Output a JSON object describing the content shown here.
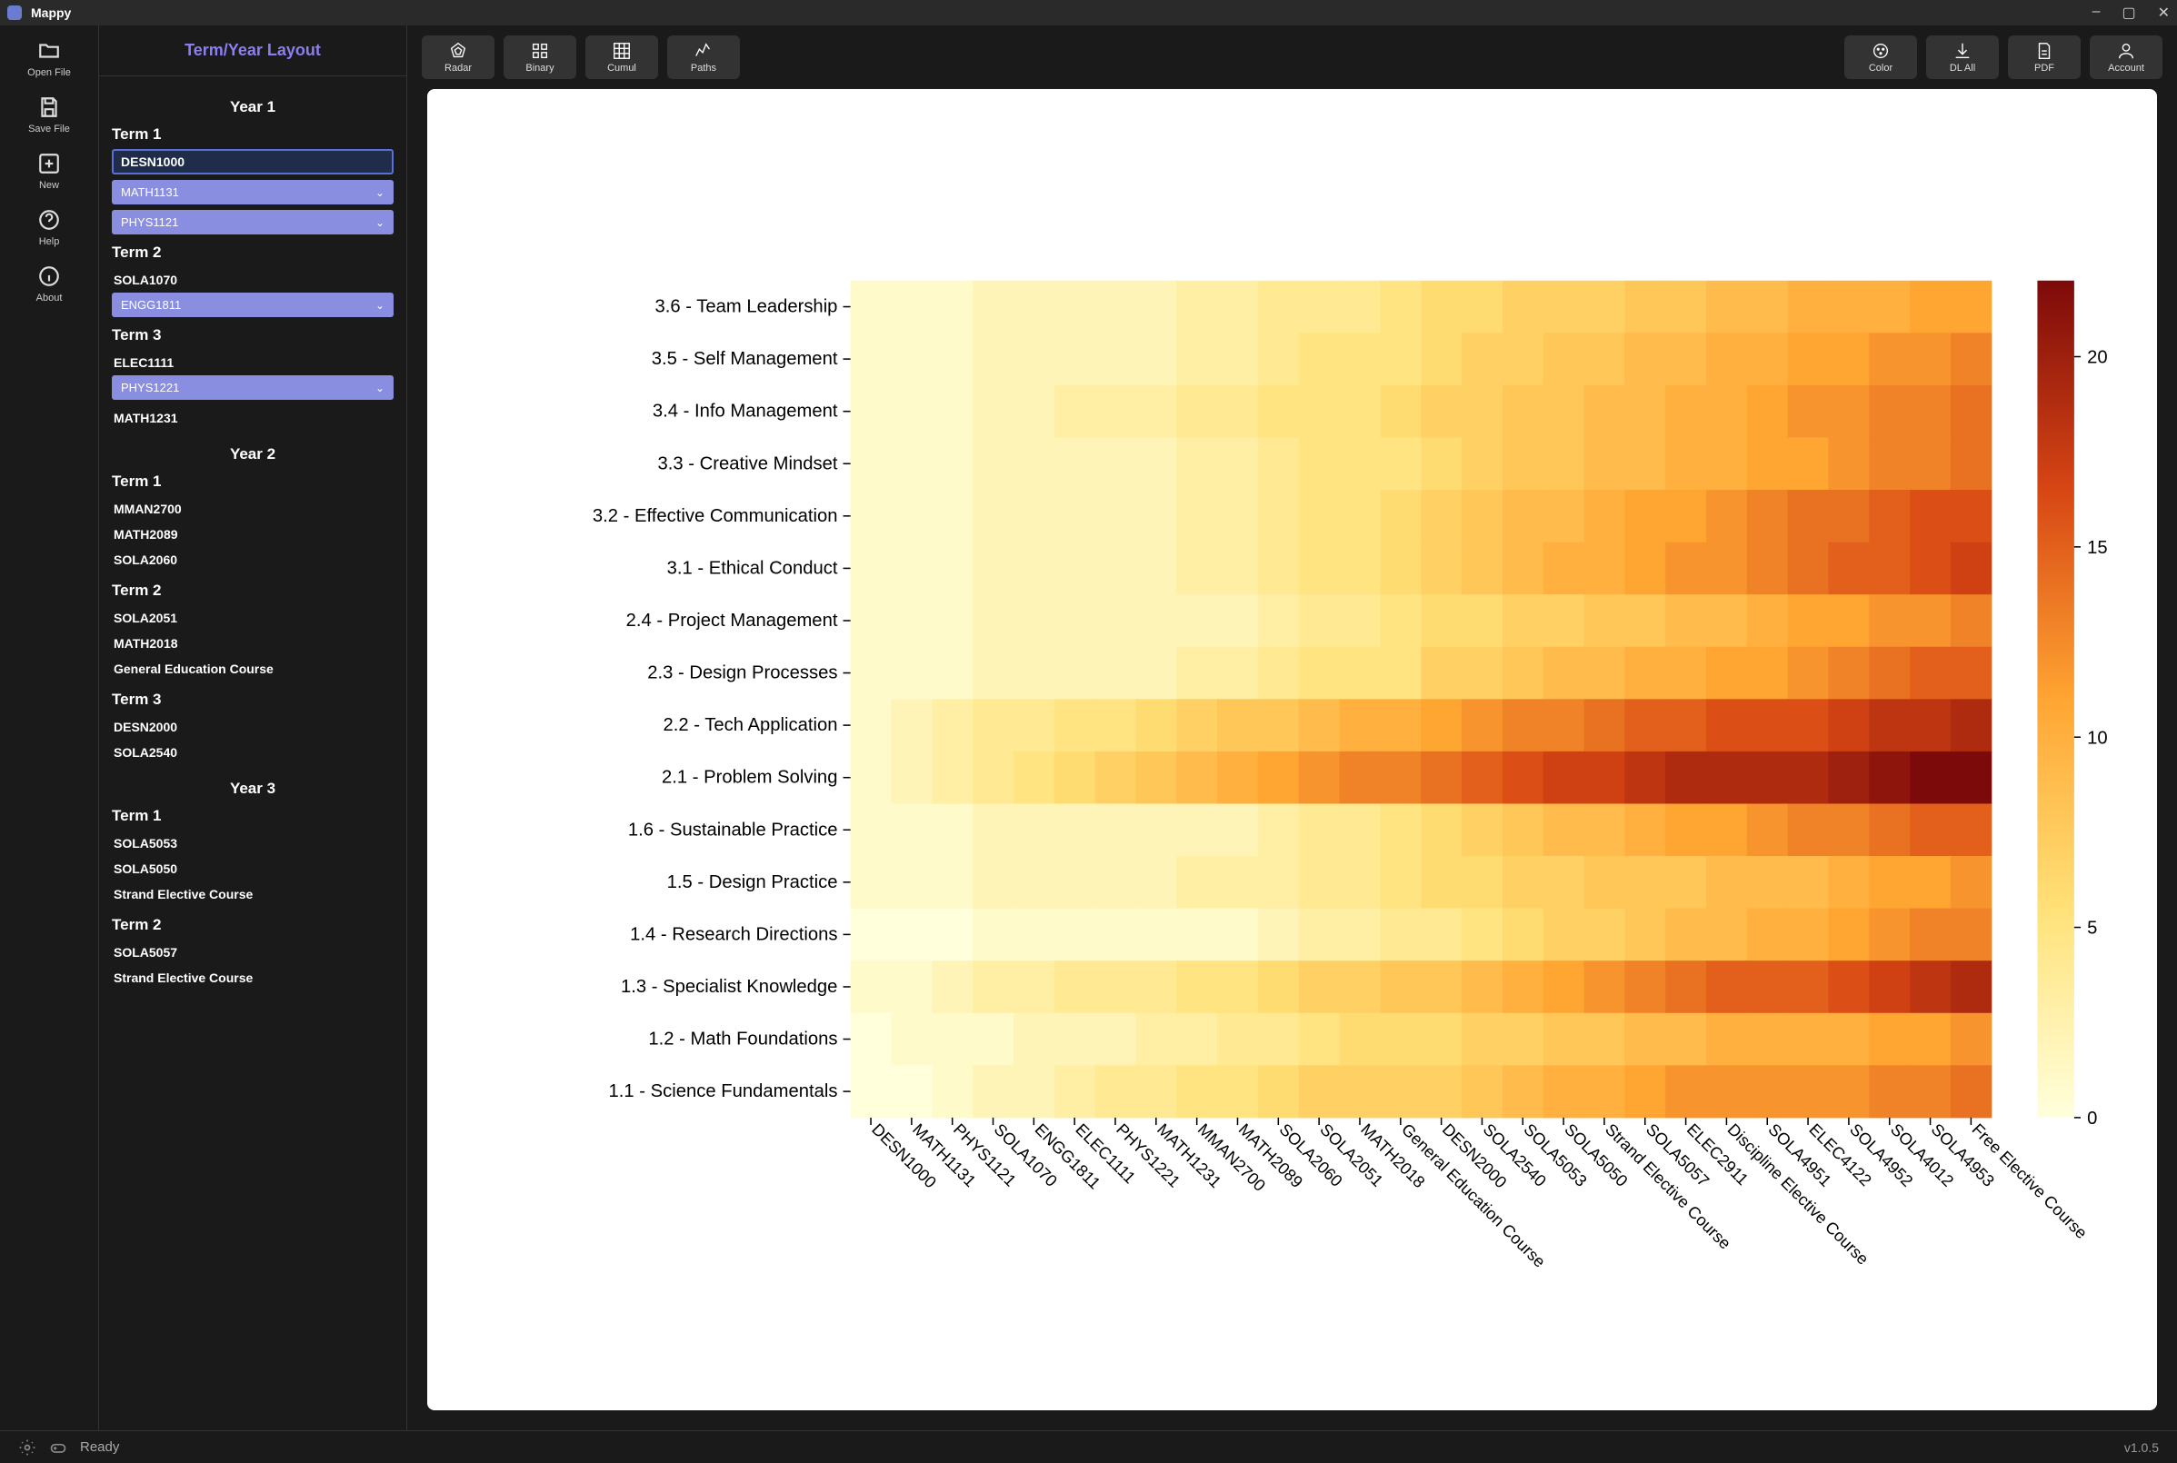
{
  "app": {
    "title": "Mappy"
  },
  "window": {
    "minimize": "–",
    "maximize": "▢",
    "close": "✕"
  },
  "rail": {
    "open": "Open File",
    "save": "Save File",
    "new": "New",
    "help": "Help",
    "about": "About"
  },
  "sidebar": {
    "title": "Term/Year Layout",
    "years": [
      {
        "name": "Year 1",
        "terms": [
          {
            "name": "Term 1",
            "courses": [
              {
                "code": "DESN1000",
                "style": "selected"
              },
              {
                "code": "MATH1131",
                "style": "pill"
              },
              {
                "code": "PHYS1121",
                "style": "pill"
              }
            ]
          },
          {
            "name": "Term 2",
            "courses": [
              {
                "code": "SOLA1070",
                "style": "plain"
              },
              {
                "code": "ENGG1811",
                "style": "pill"
              }
            ]
          },
          {
            "name": "Term 3",
            "courses": [
              {
                "code": "ELEC1111",
                "style": "plain"
              },
              {
                "code": "PHYS1221",
                "style": "pill"
              },
              {
                "code": "MATH1231",
                "style": "plain"
              }
            ]
          }
        ]
      },
      {
        "name": "Year 2",
        "terms": [
          {
            "name": "Term 1",
            "courses": [
              {
                "code": "MMAN2700",
                "style": "plain"
              },
              {
                "code": "MATH2089",
                "style": "plain"
              },
              {
                "code": "SOLA2060",
                "style": "plain"
              }
            ]
          },
          {
            "name": "Term 2",
            "courses": [
              {
                "code": "SOLA2051",
                "style": "plain"
              },
              {
                "code": "MATH2018",
                "style": "plain"
              },
              {
                "code": "General Education Course",
                "style": "plain"
              }
            ]
          },
          {
            "name": "Term 3",
            "courses": [
              {
                "code": "DESN2000",
                "style": "plain"
              },
              {
                "code": "SOLA2540",
                "style": "plain"
              }
            ]
          }
        ]
      },
      {
        "name": "Year 3",
        "terms": [
          {
            "name": "Term 1",
            "courses": [
              {
                "code": "SOLA5053",
                "style": "plain"
              },
              {
                "code": "SOLA5050",
                "style": "plain"
              },
              {
                "code": "Strand Elective Course",
                "style": "plain"
              }
            ]
          },
          {
            "name": "Term 2",
            "courses": [
              {
                "code": "SOLA5057",
                "style": "plain"
              },
              {
                "code": "Strand Elective Course",
                "style": "plain"
              }
            ]
          }
        ]
      }
    ]
  },
  "toolbar": {
    "left": [
      {
        "key": "radar",
        "label": "Radar"
      },
      {
        "key": "binary",
        "label": "Binary"
      },
      {
        "key": "cumul",
        "label": "Cumul"
      },
      {
        "key": "paths",
        "label": "Paths"
      }
    ],
    "right": [
      {
        "key": "color",
        "label": "Color"
      },
      {
        "key": "dlall",
        "label": "DL All"
      },
      {
        "key": "pdf",
        "label": "PDF"
      },
      {
        "key": "account",
        "label": "Account"
      }
    ]
  },
  "status": {
    "text": "Ready",
    "version": "v1.0.5"
  },
  "chart_data": {
    "type": "heatmap",
    "title": "",
    "ylabels": [
      "3.6 - Team Leadership",
      "3.5 - Self Management",
      "3.4 - Info Management",
      "3.3 - Creative Mindset",
      "3.2 - Effective Communication",
      "3.1 - Ethical Conduct",
      "2.4 - Project Management",
      "2.3 - Design Processes",
      "2.2 - Tech Application",
      "2.1 - Problem Solving",
      "1.6 - Sustainable Practice",
      "1.5 - Design Practice",
      "1.4 - Research Directions",
      "1.3 - Specialist Knowledge",
      "1.2 - Math Foundations",
      "1.1 - Science Fundamentals"
    ],
    "xlabels": [
      "DESN1000",
      "MATH1131",
      "PHYS1121",
      "SOLA1070",
      "ENGG1811",
      "ELEC1111",
      "PHYS1221",
      "MATH1231",
      "MMAN2700",
      "MATH2089",
      "SOLA2060",
      "SOLA2051",
      "MATH2018",
      "General Education Course",
      "DESN2000",
      "SOLA2540",
      "SOLA5053",
      "SOLA5050",
      "Strand Elective Course",
      "SOLA5057",
      "ELEC2911",
      "Discipline Elective Course",
      "SOLA4951",
      "ELEC4122",
      "SOLA4952",
      "SOLA4012",
      "SOLA4953",
      "Free Elective Course"
    ],
    "colorbar_ticks": [
      0,
      5,
      10,
      15,
      20
    ],
    "colorbar_range": [
      0,
      22
    ],
    "values": [
      [
        1,
        1,
        1,
        2,
        2,
        2,
        2,
        2,
        3,
        3,
        4,
        4,
        4,
        5,
        6,
        6,
        7,
        7,
        7,
        8,
        8,
        9,
        9,
        10,
        10,
        10,
        11,
        11
      ],
      [
        1,
        1,
        1,
        2,
        2,
        2,
        2,
        2,
        3,
        3,
        4,
        5,
        5,
        5,
        6,
        7,
        7,
        8,
        8,
        9,
        9,
        10,
        10,
        11,
        11,
        12,
        12,
        13
      ],
      [
        1,
        1,
        1,
        2,
        2,
        3,
        3,
        3,
        4,
        4,
        5,
        5,
        5,
        6,
        7,
        7,
        8,
        8,
        9,
        9,
        10,
        10,
        11,
        12,
        12,
        13,
        13,
        14
      ],
      [
        1,
        1,
        1,
        2,
        2,
        2,
        2,
        2,
        3,
        3,
        4,
        5,
        5,
        5,
        6,
        7,
        8,
        8,
        9,
        9,
        10,
        10,
        11,
        11,
        12,
        13,
        13,
        14
      ],
      [
        1,
        1,
        1,
        2,
        2,
        2,
        2,
        2,
        3,
        3,
        4,
        5,
        5,
        6,
        7,
        8,
        9,
        9,
        10,
        11,
        11,
        12,
        13,
        14,
        14,
        15,
        16,
        16
      ],
      [
        1,
        1,
        1,
        2,
        2,
        2,
        2,
        2,
        3,
        3,
        4,
        5,
        5,
        6,
        7,
        8,
        9,
        10,
        10,
        11,
        12,
        12,
        13,
        14,
        15,
        15,
        16,
        17
      ],
      [
        1,
        1,
        1,
        2,
        2,
        2,
        2,
        2,
        2,
        2,
        3,
        4,
        4,
        5,
        6,
        6,
        7,
        7,
        8,
        8,
        9,
        9,
        10,
        11,
        11,
        12,
        12,
        13
      ],
      [
        1,
        1,
        1,
        2,
        2,
        2,
        2,
        2,
        3,
        3,
        4,
        5,
        5,
        5,
        7,
        7,
        8,
        9,
        9,
        10,
        10,
        11,
        11,
        12,
        13,
        14,
        15,
        15
      ],
      [
        1,
        2,
        3,
        4,
        4,
        5,
        5,
        6,
        7,
        8,
        8,
        9,
        10,
        10,
        11,
        12,
        13,
        13,
        14,
        15,
        15,
        16,
        16,
        16,
        17,
        18,
        18,
        19
      ],
      [
        1,
        2,
        3,
        4,
        5,
        6,
        7,
        8,
        9,
        10,
        11,
        12,
        13,
        13,
        14,
        15,
        16,
        17,
        17,
        18,
        19,
        19,
        19,
        19,
        20,
        21,
        22,
        22
      ],
      [
        1,
        1,
        1,
        2,
        2,
        2,
        2,
        2,
        2,
        2,
        3,
        4,
        4,
        5,
        6,
        7,
        8,
        9,
        9,
        10,
        11,
        11,
        12,
        13,
        13,
        14,
        15,
        15
      ],
      [
        1,
        1,
        1,
        2,
        2,
        2,
        2,
        2,
        3,
        3,
        3,
        4,
        4,
        5,
        6,
        6,
        7,
        7,
        8,
        8,
        8,
        9,
        9,
        9,
        10,
        11,
        11,
        12
      ],
      [
        0,
        0,
        0,
        1,
        1,
        1,
        1,
        1,
        1,
        1,
        2,
        3,
        3,
        4,
        4,
        5,
        6,
        7,
        7,
        8,
        9,
        9,
        10,
        10,
        11,
        12,
        13,
        13
      ],
      [
        1,
        1,
        2,
        3,
        3,
        4,
        4,
        4,
        5,
        5,
        6,
        7,
        7,
        8,
        8,
        9,
        10,
        11,
        12,
        13,
        14,
        15,
        15,
        15,
        16,
        17,
        18,
        19
      ],
      [
        0,
        1,
        1,
        1,
        2,
        2,
        2,
        3,
        3,
        4,
        4,
        5,
        6,
        6,
        6,
        7,
        7,
        8,
        8,
        9,
        9,
        10,
        10,
        10,
        10,
        11,
        11,
        12
      ],
      [
        0,
        0,
        1,
        2,
        2,
        3,
        4,
        4,
        5,
        5,
        6,
        7,
        7,
        7,
        7,
        8,
        9,
        10,
        10,
        11,
        12,
        12,
        12,
        12,
        12,
        13,
        13,
        14
      ]
    ]
  }
}
